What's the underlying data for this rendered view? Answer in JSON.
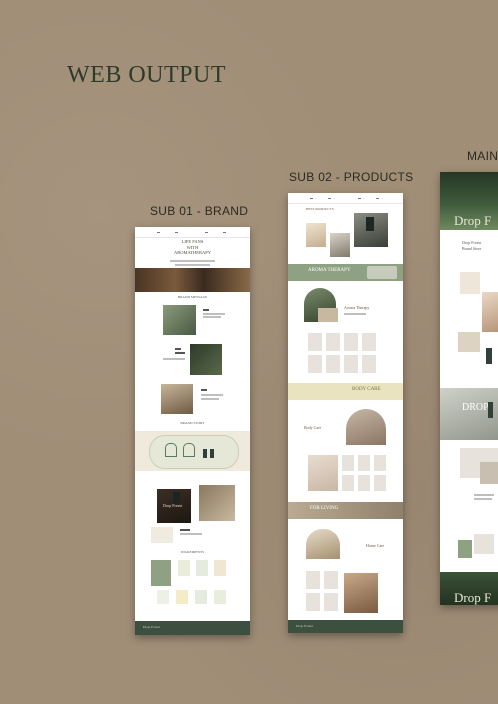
{
  "page": {
    "title": "WEB OUTPUT",
    "background_color": "#a18e77"
  },
  "panels": [
    {
      "id": "sub01",
      "label": "SUB 01 - BRAND",
      "headline_lines": [
        "LIFE FANS",
        "WITH",
        "AROMATHERAPY"
      ],
      "sections": [
        "BRAND MESSAGE",
        "BRAND STORY",
        "INGREDIENTS"
      ],
      "product_name": "Drop Forest",
      "footer_logo": "Drop Forest"
    },
    {
      "id": "sub02",
      "label": "SUB 02 - PRODUCTS",
      "sections": [
        "BEST PRODUCTS",
        "AROMA THERAPY",
        "Aroma Therapy",
        "BODY CARE",
        "Body Care",
        "FOR LIVING",
        "Home Care"
      ],
      "footer_logo": "Drop Forest"
    },
    {
      "id": "main",
      "label": "MAIN",
      "hero_text": "Drop F",
      "mid_text": "DROP",
      "footer_text": "Drop F",
      "brand_name": "Drop Forest",
      "brand_sub": "Brand Store"
    }
  ],
  "colors": {
    "dark_green": "#3d4f3e",
    "sage": "#8fa183",
    "beige": "#e8dfcf",
    "title_color": "#2e3a2a"
  }
}
